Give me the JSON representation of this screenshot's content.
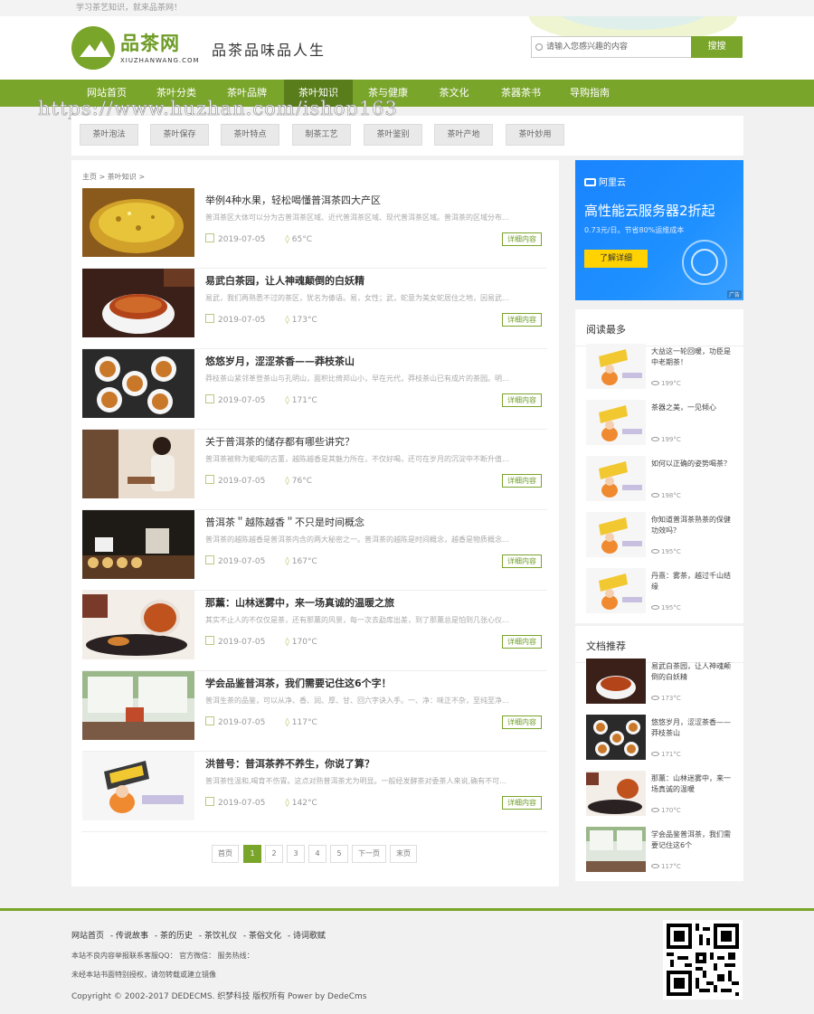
{
  "topbar": {
    "text": "学习茶艺知识，就来品茶网！"
  },
  "header": {
    "brand": "品茶网",
    "domain": "XIUZHANWANG.COM",
    "slogan": "品茶品味品人生",
    "search": {
      "placeholder": "请输入您感兴趣的内容",
      "button": "搜搜"
    }
  },
  "nav": {
    "items": [
      "网站首页",
      "茶叶分类",
      "茶叶品牌",
      "茶叶知识",
      "茶与健康",
      "茶文化",
      "茶器茶书",
      "导购指南"
    ],
    "active": "茶叶知识"
  },
  "watermark": "https://www.huzhan.com/ishop163",
  "subnav": [
    "茶叶泡法",
    "茶叶保存",
    "茶叶特点",
    "制茶工艺",
    "茶叶鉴别",
    "茶叶产地",
    "茶叶妙用"
  ],
  "breadcrumb": "主页 > 茶叶知识 >",
  "articles": [
    {
      "title": "举例4种水果，轻松喝懂普洱茶四大产区",
      "summary": "普洱茶区大体可以分为古普洱茶区域、近代普洱茶区域、现代普洱茶区域。普洱茶的区域分布...",
      "date": "2019-07-05",
      "views": "65°C",
      "more": "详细内容",
      "bold": false
    },
    {
      "title": "易武白茶园，让人神魂颠倒的白妖精",
      "summary": "易武，我们再熟悉不过的茶区，犹名为傣语。易，女性；武，蛇意为美女蛇居住之地，因易武...",
      "date": "2019-07-05",
      "views": "173°C",
      "more": "详细内容",
      "bold": true
    },
    {
      "title": "悠悠岁月，涩涩茶香——莽枝茶山",
      "summary": "莽枝茶山紧邻革登茶山与孔明山，面积比倚邦山小，早在元代，莽枝茶山已有成片的茶园。明...",
      "date": "2019-07-05",
      "views": "171°C",
      "more": "详细内容",
      "bold": true
    },
    {
      "title": "关于普洱茶的储存都有哪些讲究？",
      "summary": "普洱茶被称为能喝的古董，越陈越香是其魅力所在，不仅好喝，还可在岁月的沉淀中不断升值...",
      "date": "2019-07-05",
      "views": "76°C",
      "more": "详细内容",
      "bold": false
    },
    {
      "title": "普洱茶＂越陈越香＂不只是时间概念",
      "summary": "普洱茶的越陈越香是普洱茶内含的两大秘密之一。普洱茶的越陈是时间概念，越香是物质概念...",
      "date": "2019-07-05",
      "views": "167°C",
      "more": "详细内容",
      "bold": false
    },
    {
      "title": "那薰：山林迷雾中，来一场真诚的温暖之旅",
      "summary": "其实不止人的不仅仅是茶，还有那薰的风景，每一次去勐库出差，到了那薰总是怕到几张心仪...",
      "date": "2019-07-05",
      "views": "170°C",
      "more": "详细内容",
      "bold": true
    },
    {
      "title": "学会品鉴普洱茶，我们需要记住这6个字！",
      "summary": "普洱生茶的品鉴，可以从净、香、润、厚、甘、回六字诀入手。一、净：味正不杂，至纯至净...",
      "date": "2019-07-05",
      "views": "117°C",
      "more": "详细内容",
      "bold": true
    },
    {
      "title": "洪普号：普洱茶养不养生，你说了算？",
      "summary": "普洱茶性温和,喝育不伤胃。这点对熟普洱茶尤为明显。一般经发酵茶对委茶人来说,确有不可...",
      "date": "2019-07-05",
      "views": "142°C",
      "more": "详细内容",
      "bold": true
    }
  ],
  "pagination": [
    "首页",
    "1",
    "2",
    "3",
    "4",
    "5",
    "下一页",
    "末页"
  ],
  "ad": {
    "brand": "阿里云",
    "headline": "高性能云服务器2折起",
    "sub": "0.73元/日。节省80%运维成本",
    "cta": "了解详细",
    "tag": "广告"
  },
  "most_read": {
    "heading": "阅读最多",
    "items": [
      {
        "title": "大益这一轮回暖，功臣是中老期茶！",
        "views": "199°C"
      },
      {
        "title": "茶器之美，一见倾心",
        "views": "199°C"
      },
      {
        "title": "如何以正确的姿势喝茶？",
        "views": "198°C"
      },
      {
        "title": "你知道普洱茶熟茶的保健功效吗？",
        "views": "195°C"
      },
      {
        "title": "丹熹：雾茶，越过千山结缘",
        "views": "195°C"
      }
    ]
  },
  "recommend": {
    "heading": "文档推荐",
    "items": [
      {
        "title": "易武白茶园，让人神魂颠倒的白妖精",
        "views": "173°C"
      },
      {
        "title": "悠悠岁月，涩涩茶香——莽枝茶山",
        "views": "171°C"
      },
      {
        "title": "那薰：山林迷雾中，来一场真诚的温暖",
        "views": "170°C"
      },
      {
        "title": "学会品鉴普洱茶，我们需要记住这6个",
        "views": "117°C"
      }
    ]
  },
  "footer": {
    "links": [
      "网站首页",
      "- 传说故事",
      "- 茶的历史",
      "- 茶饮礼仪",
      "- 茶俗文化",
      "- 诗词歌赋"
    ],
    "line1": "本站不良内容举报联系客服QQ：   官方微信：  服务热线：",
    "line2": "未经本站书面特别授权，请勿转载或建立镜像",
    "copyright": "Copyright © 2002-2017 DEDECMS. 织梦科技 版权所有 Power by DedeCms"
  },
  "colors": {
    "brand_green": "#7aa52b",
    "nav_active": "#5a7d1c",
    "ad_blue": "#1a84ff",
    "cta_yellow": "#ffd200"
  }
}
